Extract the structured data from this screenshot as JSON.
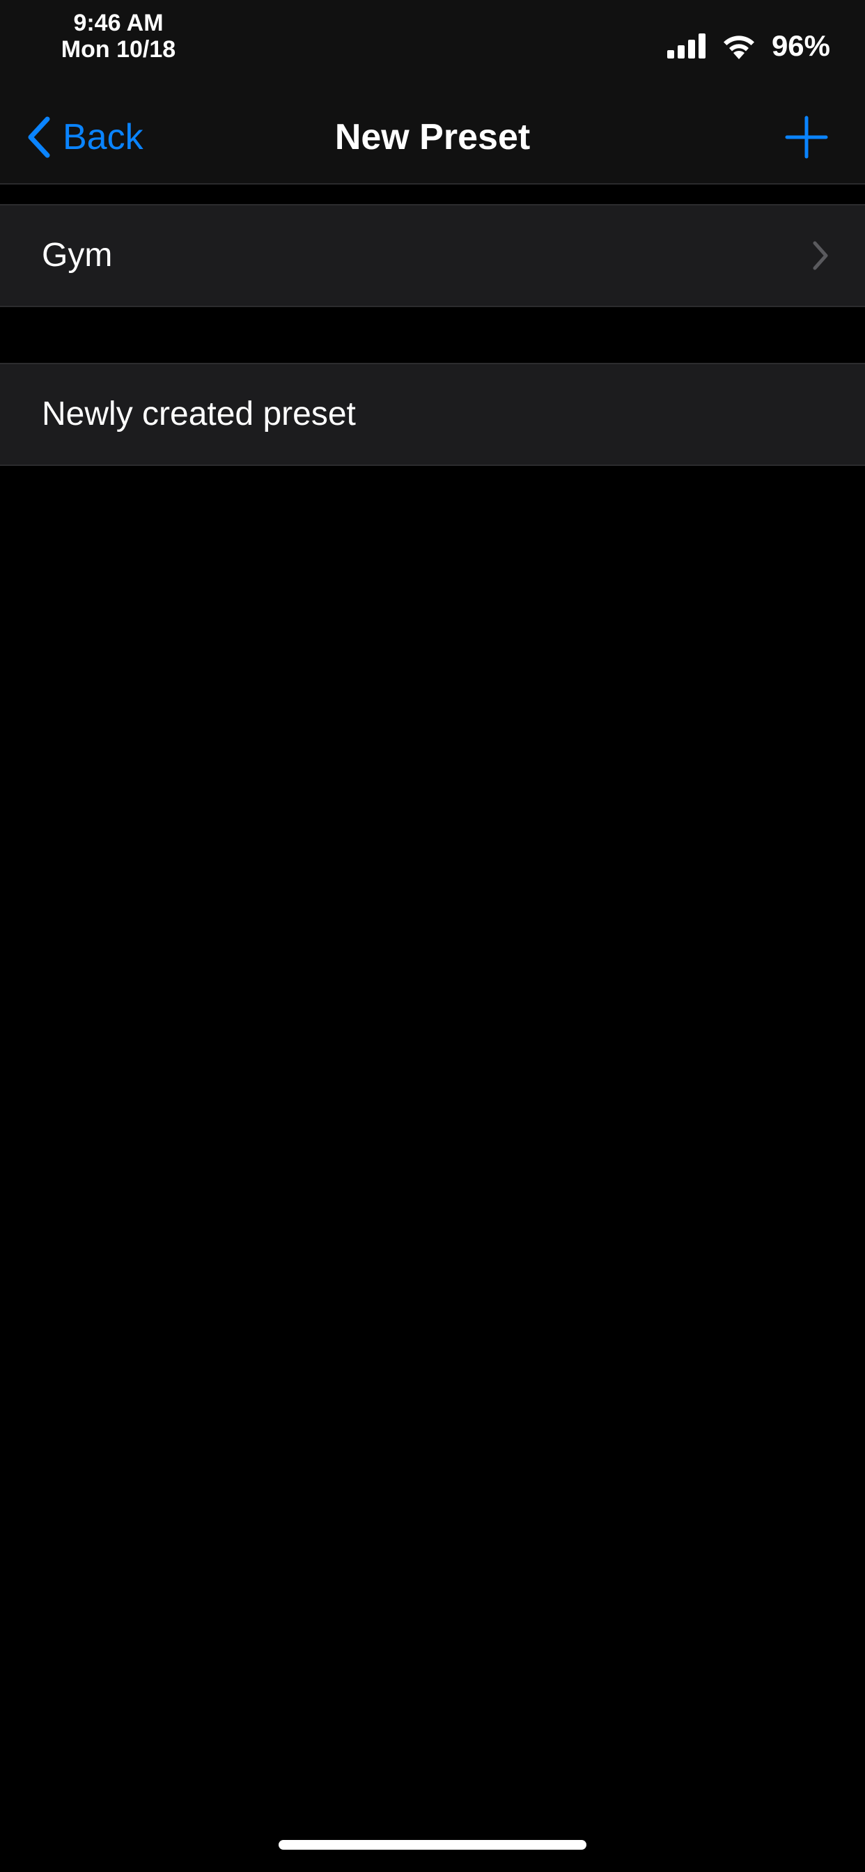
{
  "status_bar": {
    "time": "9:46 AM",
    "date": "Mon 10/18",
    "battery": "96%",
    "icons": [
      "cellular-signal-icon",
      "wifi-icon"
    ]
  },
  "nav": {
    "back_label": "Back",
    "title": "New Preset",
    "back_icon": "chevron-left-icon",
    "add_icon": "plus-icon"
  },
  "list": {
    "groups": [
      {
        "rows": [
          {
            "label": "Gym",
            "accessory": "chevron-right-icon"
          }
        ]
      },
      {
        "rows": [
          {
            "label": "Newly created preset"
          }
        ]
      }
    ]
  },
  "colors": {
    "accent": "#0a84ff",
    "background": "#000000",
    "bar_background": "#111111",
    "cell_background": "#1c1c1e",
    "chevron": "#5a5a5e",
    "text": "#ffffff"
  }
}
